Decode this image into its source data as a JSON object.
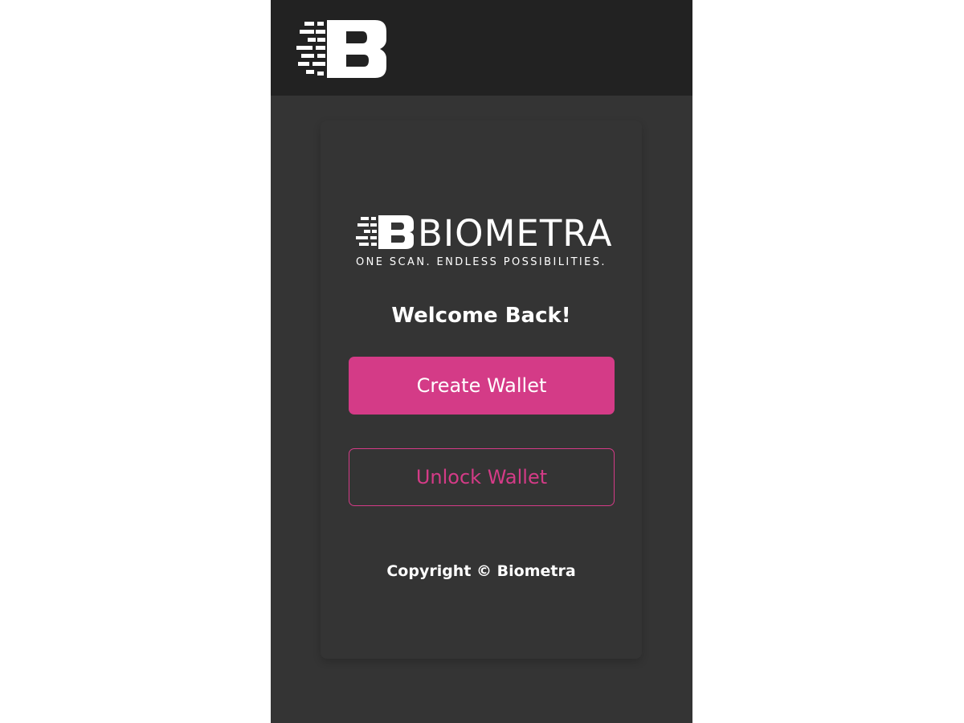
{
  "colors": {
    "app_background": "#343434",
    "topbar_background": "#222222",
    "accent": "#d43b87",
    "text": "#ffffff"
  },
  "topbar": {
    "logo_icon": "biometra-b-logo-icon"
  },
  "brand": {
    "logo_icon": "biometra-wordmark-logo",
    "name": "BIOMETRA",
    "tagline": "ONE SCAN. ENDLESS POSSIBILITIES."
  },
  "main": {
    "welcome": "Welcome Back!",
    "create_wallet_label": "Create Wallet",
    "unlock_wallet_label": "Unlock Wallet",
    "copyright": "Copyright © Biometra"
  }
}
